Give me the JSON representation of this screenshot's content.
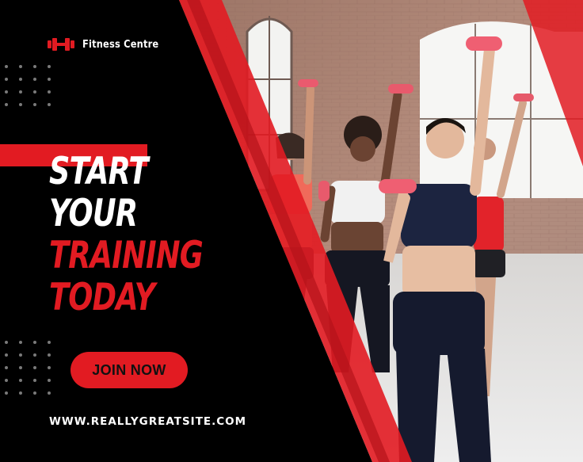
{
  "brand": {
    "name": "Fitness Centre",
    "logo_icon": "dumbbell-icon"
  },
  "headline": {
    "line1": "START",
    "line2": "YOUR",
    "line3": "TRAINING",
    "line4": "TODAY"
  },
  "cta": {
    "label": "JOIN NOW"
  },
  "footer": {
    "website": "WWW.REALLYGREATSITE.COM"
  },
  "colors": {
    "accent": "#e21b22",
    "panel": "#000000",
    "text": "#ffffff"
  }
}
